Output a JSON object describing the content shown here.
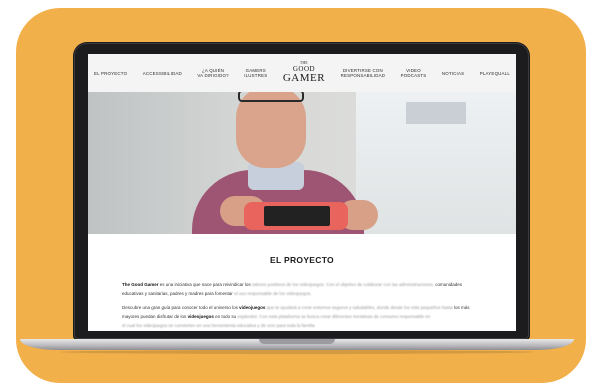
{
  "nav": {
    "items": [
      "EL PROYECTO",
      "ACCESSIBILIDAD",
      "¿A QUIÉN\nVA DIRIGIDO?",
      "GAMERS\nILUSTRES",
      "DIVERTIRSE CON\nRESPONSABILIDAD",
      "VIDEO\nPODCASTS",
      "NOTICIAS",
      "PLAYEQUALL"
    ],
    "logo": {
      "the": "THE",
      "good": "GOOD",
      "gamer": "GAMER"
    }
  },
  "content": {
    "title": "EL PROYECTO",
    "p1_lead": "The Good Gamer",
    "p1_text": "es una iniciativa que nace para reivindicar los",
    "p1_blur": "valores positivos de los videojuegos. Con el objetivo de colaborar con las administraciones,",
    "p1_text2": "comunidades educativas y sanitarias, padres y madres para fomentar",
    "p1_blur2": "el uso responsable de los videojuegos.",
    "p2_text": "Descubre una gran guía para conocer todo el universo los",
    "p2_bold": "videojuegos",
    "p2_blur": "que te ayudará a crear entornos seguros y saludables, donde desde los más pequeños hasta",
    "p2_text2": "los más mayores puedan disfrutar de los",
    "p2_bold2": "videojuegos",
    "p2_text3": "en todo su",
    "p2_blur2": "esplendor. Con esta plataforma se busca crear diferentes iniciativas de consumo responsable en",
    "p3_blur": "el cual los videojuegos se convierten en una herramienta educativa y de ocio para toda la familia"
  }
}
